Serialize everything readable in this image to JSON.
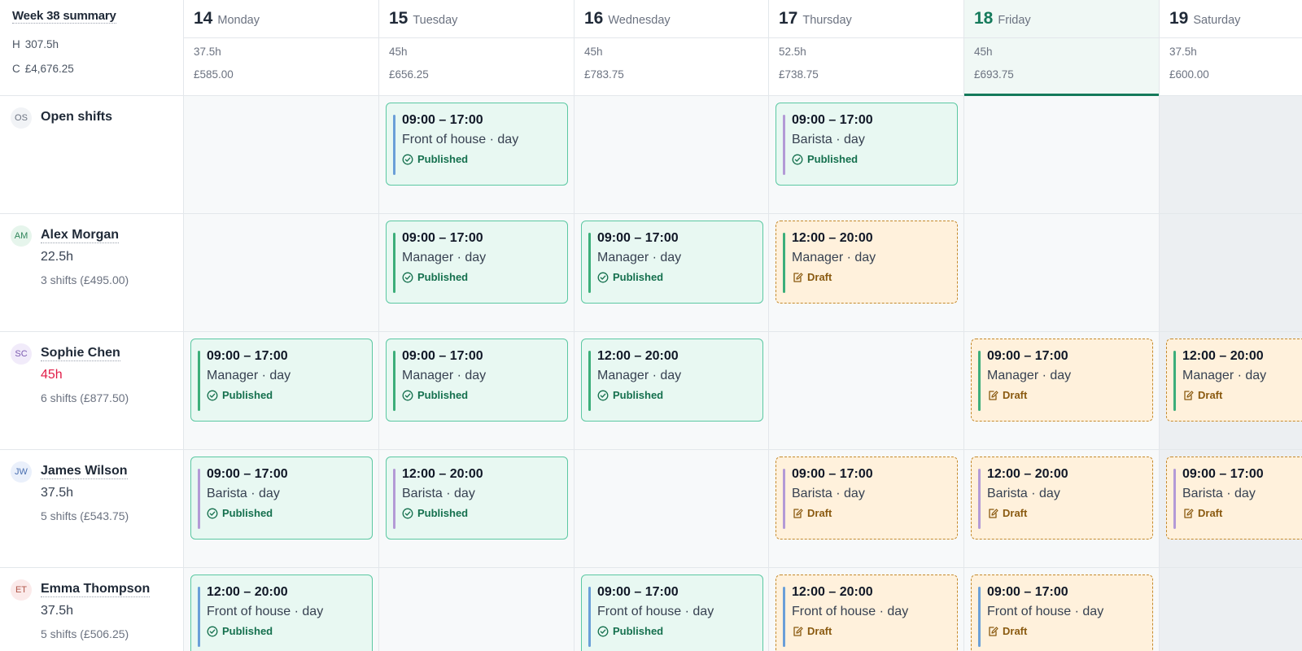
{
  "summary": {
    "title": "Week 38 summary",
    "hours_key": "H",
    "hours_value": "307.5h",
    "cost_key": "C",
    "cost_value": "£4,676.25"
  },
  "days": [
    {
      "num": "14",
      "name": "Monday",
      "hours": "37.5h",
      "cost": "£585.00"
    },
    {
      "num": "15",
      "name": "Tuesday",
      "hours": "45h",
      "cost": "£656.25"
    },
    {
      "num": "16",
      "name": "Wednesday",
      "hours": "45h",
      "cost": "£783.75"
    },
    {
      "num": "17",
      "name": "Thursday",
      "hours": "52.5h",
      "cost": "£738.75"
    },
    {
      "num": "18",
      "name": "Friday",
      "hours": "45h",
      "cost": "£693.75"
    },
    {
      "num": "19",
      "name": "Saturday",
      "hours": "37.5h",
      "cost": "£600.00"
    }
  ],
  "colors": {
    "accent": "#157a5b",
    "published_bg": "#e8f8f2",
    "published_border": "#5bc8a2",
    "draft_bg": "#fff1dc",
    "draft_border": "#c58a2c",
    "overtime": "#e11d48",
    "role_front_of_house": "#6a9fd8",
    "role_barista": "#b39ad6",
    "role_manager": "#3cae7a"
  },
  "rows": [
    {
      "initials": "OS",
      "name": "Open shifts",
      "hours": "",
      "shifts": "",
      "shift_items": [
        {
          "time": "09:00 – 17:00",
          "role": "Front of house · day",
          "status": "Published"
        },
        {
          "time": "09:00 – 17:00",
          "role": "Barista · day",
          "status": "Published"
        }
      ]
    },
    {
      "initials": "AM",
      "name": "Alex Morgan",
      "hours": "22.5h",
      "shifts": "3 shifts (£495.00)",
      "shift_items": [
        {
          "time": "09:00 – 17:00",
          "role": "Manager · day",
          "status": "Published"
        },
        {
          "time": "09:00 – 17:00",
          "role": "Manager · day",
          "status": "Published"
        },
        {
          "time": "12:00 – 20:00",
          "role": "Manager · day",
          "status": "Draft"
        }
      ]
    },
    {
      "initials": "SC",
      "name": "Sophie Chen",
      "hours": "45h",
      "shifts": "6 shifts (£877.50)",
      "shift_items": [
        {
          "time": "09:00 – 17:00",
          "role": "Manager · day",
          "status": "Published"
        },
        {
          "time": "09:00 – 17:00",
          "role": "Manager · day",
          "status": "Published"
        },
        {
          "time": "12:00 – 20:00",
          "role": "Manager · day",
          "status": "Published"
        },
        {
          "time": "09:00 – 17:00",
          "role": "Manager · day",
          "status": "Draft"
        },
        {
          "time": "12:00 – 20:00",
          "role": "Manager · day",
          "status": "Draft"
        }
      ]
    },
    {
      "initials": "JW",
      "name": "James Wilson",
      "hours": "37.5h",
      "shifts": "5 shifts (£543.75)",
      "shift_items": [
        {
          "time": "09:00 – 17:00",
          "role": "Barista · day",
          "status": "Published"
        },
        {
          "time": "12:00 – 20:00",
          "role": "Barista · day",
          "status": "Published"
        },
        {
          "time": "09:00 – 17:00",
          "role": "Barista · day",
          "status": "Draft"
        },
        {
          "time": "12:00 – 20:00",
          "role": "Barista · day",
          "status": "Draft"
        },
        {
          "time": "09:00 – 17:00",
          "role": "Barista · day",
          "status": "Draft"
        }
      ]
    },
    {
      "initials": "ET",
      "name": "Emma Thompson",
      "hours": "37.5h",
      "shifts": "5 shifts (£506.25)",
      "shift_items": [
        {
          "time": "12:00 – 20:00",
          "role": "Front of house · day",
          "status": "Published"
        },
        {
          "time": "09:00 – 17:00",
          "role": "Front of house · day",
          "status": "Published"
        },
        {
          "time": "12:00 – 20:00",
          "role": "Front of house · day",
          "status": "Draft"
        },
        {
          "time": "09:00 – 17:00",
          "role": "Front of house · day",
          "status": "Draft"
        }
      ]
    }
  ]
}
